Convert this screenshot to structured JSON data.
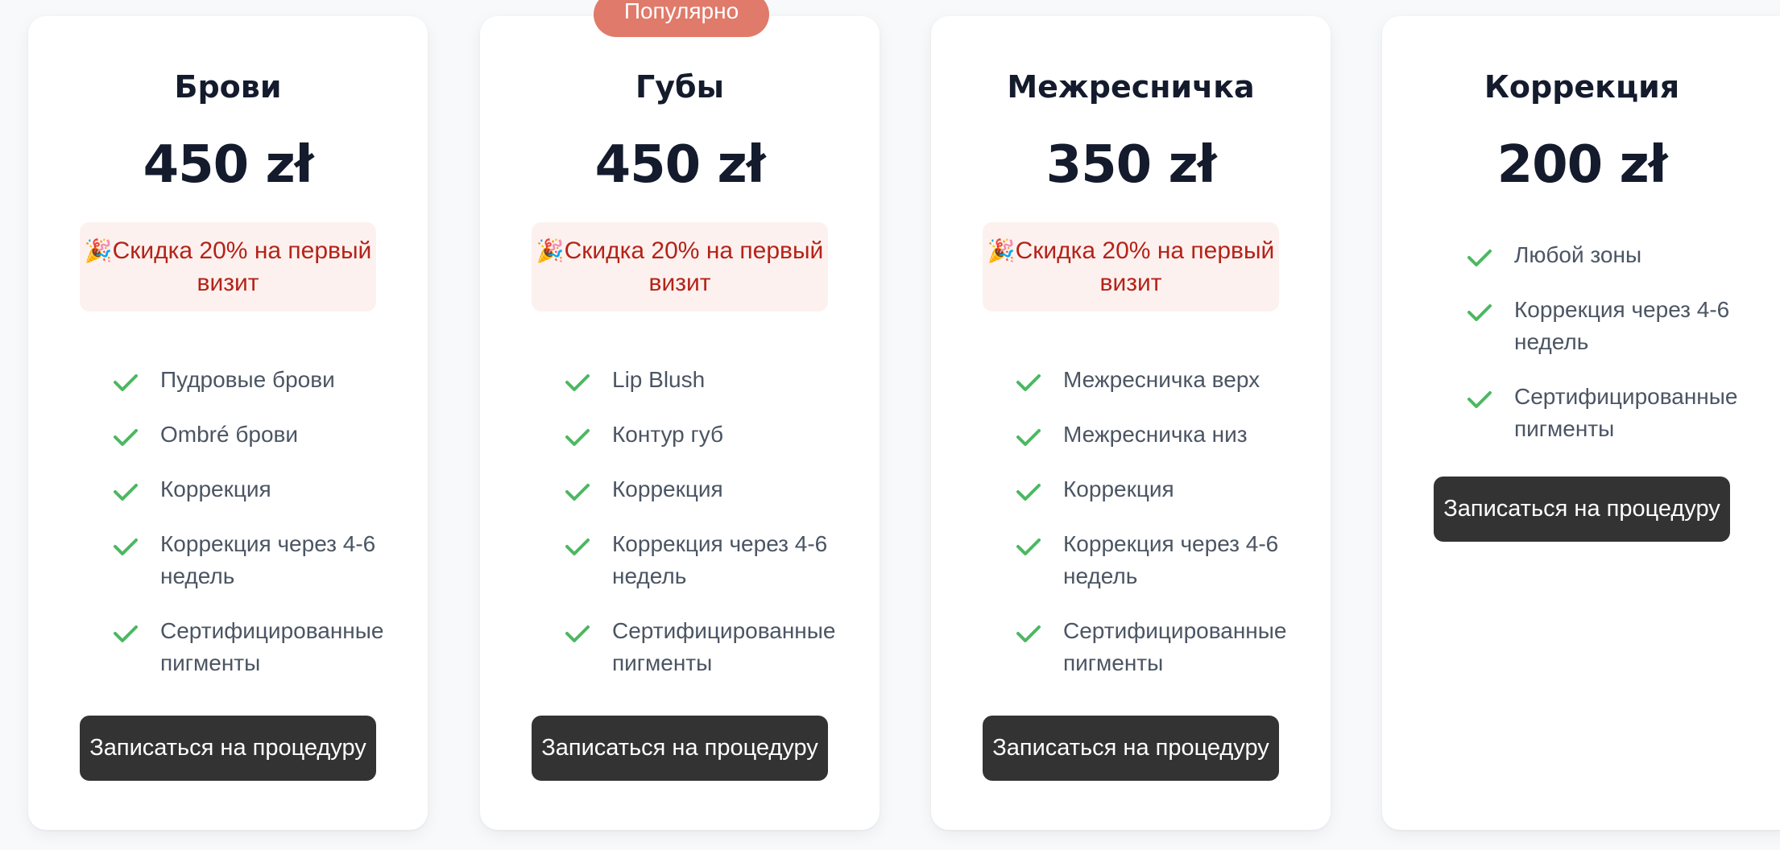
{
  "badge": "Популярно",
  "promo_emoji": "🎉",
  "cards": [
    {
      "title": "Брови",
      "price": "450 zł",
      "promo": "Скидка 20% на первый визит",
      "features": [
        "Пудровые брови",
        "Ombré брови",
        "Коррекция",
        "Коррекция через 4-6 недель",
        "Сертифицированные пигменты"
      ],
      "button": "Записаться на процедуру"
    },
    {
      "title": "Губы",
      "price": "450 zł",
      "promo": "Скидка 20% на первый визит",
      "features": [
        "Lip Blush",
        "Контур губ",
        "Коррекция",
        "Коррекция через 4-6 недель",
        "Сертифицированные пигменты"
      ],
      "button": "Записаться на процедуру"
    },
    {
      "title": "Межресничка",
      "price": "350 zł",
      "promo": "Скидка 20% на первый визит",
      "features": [
        "Межресничка верх",
        "Межресничка низ",
        "Коррекция",
        "Коррекция через 4-6 недель",
        "Сертифицированные пигменты"
      ],
      "button": "Записаться на процедуру"
    },
    {
      "title": "Коррекция",
      "price": "200 zł",
      "features": [
        "Любой зоны",
        "Коррекция через 4-6 недель",
        "Сертифицированные пигменты"
      ],
      "button": "Записаться на процедуру"
    }
  ],
  "colors": {
    "check": "#4cb862",
    "badge": "#e07a6a",
    "promo_bg": "#fdf1ef",
    "promo_text": "#b42318",
    "button_bg": "#333333"
  }
}
